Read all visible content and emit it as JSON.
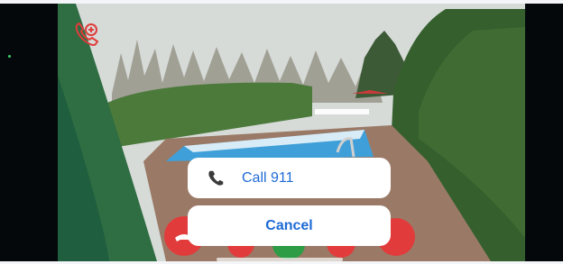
{
  "action_sheet": {
    "call_label": "Call 911",
    "call_icon": "phone-icon",
    "cancel_label": "Cancel"
  },
  "overlay": {
    "emergency_call_icon": "phone-emergency-icon"
  },
  "call_controls": {
    "hangup_icon": "hangup-icon",
    "answer_icon": "answer-icon"
  },
  "colors": {
    "accent": "#1e6bd6",
    "danger": "#e23b3b",
    "success": "#2e9b45"
  }
}
